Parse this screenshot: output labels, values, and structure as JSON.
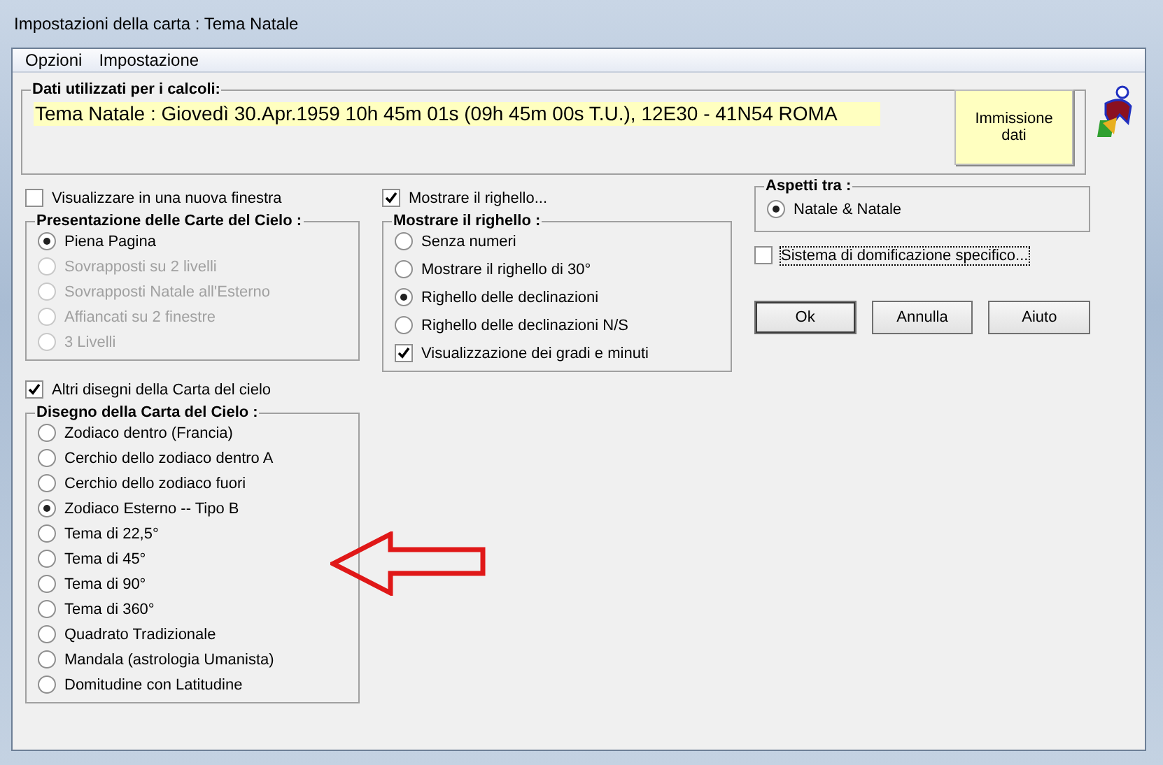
{
  "window": {
    "title": "Impostazioni della carta : Tema Natale"
  },
  "menu": [
    "Opzioni",
    "Impostazione"
  ],
  "data_group": {
    "title": "Dati utilizzati per i calcoli:",
    "value": "Tema Natale : Giovedì 30.Apr.1959 10h 45m 01s (09h 45m 00s T.U.), 12E30 - 41N54  ROMA",
    "button": "Immissione dati"
  },
  "new_window": {
    "label": "Visualizzare in una nuova finestra",
    "checked": false
  },
  "presentation": {
    "title": "Presentazione delle Carte del Cielo :",
    "options": [
      {
        "label": "Piena Pagina",
        "selected": true,
        "disabled": false
      },
      {
        "label": "Sovrapposti su 2 livelli",
        "selected": false,
        "disabled": true
      },
      {
        "label": "Sovrapposti Natale all'Esterno",
        "selected": false,
        "disabled": true
      },
      {
        "label": "Affiancati su 2 finestre",
        "selected": false,
        "disabled": true
      },
      {
        "label": "3 Livelli",
        "selected": false,
        "disabled": true
      }
    ]
  },
  "other_drawings": {
    "label": "Altri disegni della Carta del cielo",
    "checked": true
  },
  "drawing": {
    "title": "Disegno della Carta del Cielo :",
    "options": [
      {
        "label": "Zodiaco dentro (Francia)",
        "selected": false
      },
      {
        "label": "Cerchio dello zodiaco dentro A",
        "selected": false
      },
      {
        "label": "Cerchio dello zodiaco fuori",
        "selected": false
      },
      {
        "label": "Zodiaco Esterno -- Tipo B",
        "selected": true
      },
      {
        "label": "Tema di 22,5°",
        "selected": false
      },
      {
        "label": "Tema di 45°",
        "selected": false
      },
      {
        "label": "Tema di 90°",
        "selected": false
      },
      {
        "label": "Tema di 360°",
        "selected": false
      },
      {
        "label": "Quadrato Tradizionale",
        "selected": false
      },
      {
        "label": "Mandala (astrologia Umanista)",
        "selected": false
      },
      {
        "label": "Domitudine con Latitudine",
        "selected": false
      }
    ]
  },
  "show_ruler": {
    "label": "Mostrare il righello...",
    "checked": true
  },
  "ruler": {
    "title": "Mostrare il righello :",
    "options": [
      {
        "label": "Senza numeri",
        "selected": false
      },
      {
        "label": "Mostrare il righello di 30°",
        "selected": false
      },
      {
        "label": "Righello delle declinazioni",
        "selected": true
      },
      {
        "label": "Righello delle declinazioni N/S",
        "selected": false
      }
    ],
    "degrees": {
      "label": "Visualizzazione dei gradi e minuti",
      "checked": true
    }
  },
  "aspects": {
    "title": "Aspetti tra :",
    "options": [
      {
        "label": "Natale & Natale",
        "selected": true
      }
    ]
  },
  "house_system": {
    "label": "Sistema di domificazione specifico...",
    "checked": false
  },
  "buttons": [
    "Ok",
    "Annulla",
    "Aiuto"
  ]
}
